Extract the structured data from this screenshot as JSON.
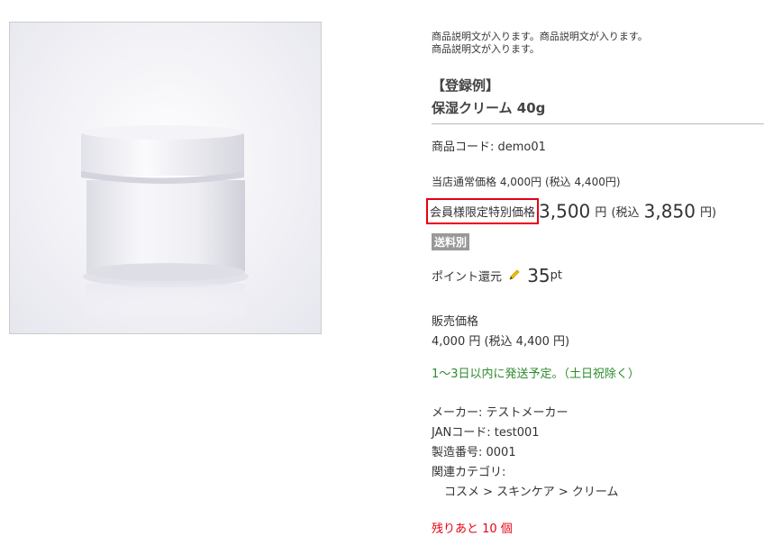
{
  "product": {
    "description_line1": "商品説明文が入ります。商品説明文が入ります。",
    "description_line2": "商品説明文が入ります。",
    "example_tag": "【登録例】",
    "name": "保湿クリーム 40g",
    "code": "商品コード: demo01",
    "regular_price": "当店通常価格 4,000円 (税込 4,400円)",
    "member_price": {
      "label": "会員様限定特別価格",
      "price": "3,500",
      "unit": "円",
      "tax_open": "(税込",
      "tax_price": "3,850",
      "tax_close": "円)"
    },
    "shipping_badge": "送料別",
    "points": {
      "label": "ポイント還元",
      "value": "35",
      "unit": "pt",
      "icon": "pencil-icon"
    },
    "sale": {
      "label": "販売価格",
      "price": "4,000 円 (税込 4,400 円)"
    },
    "shipping_note": "1〜3日以内に発送予定。（土日祝除く）",
    "specs": {
      "maker": "メーカー: テストメーカー",
      "jan": "JANコード: test001",
      "serial": "製造番号: 0001",
      "category_label": "関連カテゴリ:",
      "category_path": "コスメ > スキンケア > クリーム"
    },
    "stock": "残りあと 10 個"
  },
  "colors": {
    "highlight_border": "#e60012",
    "ship_note": "#2e8b2e",
    "badge_bg": "#999999"
  }
}
